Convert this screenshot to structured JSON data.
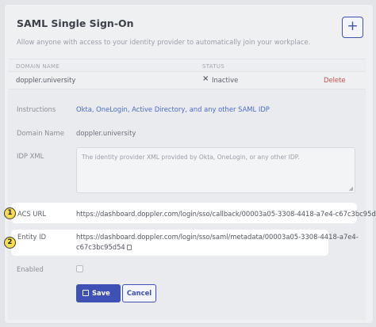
{
  "header": {
    "title": "SAML Single Sign-On",
    "subtitle": "Allow anyone with access to your identity provider to automatically join your workplace.",
    "add_label": "+"
  },
  "table": {
    "columns": [
      "DOMAIN NAME",
      "STATUS"
    ],
    "rows": [
      {
        "domain": "doppler.university",
        "status_icon": "×",
        "status": "Inactive",
        "action": "Delete"
      }
    ]
  },
  "form": {
    "instructions_label": "Instructions",
    "instructions_value": "Okta, OneLogin, Active Directory, and any other SAML IDP",
    "domain_label": "Domain Name",
    "domain_value": "doppler.university",
    "idp_label": "IDP XML",
    "idp_placeholder": "The identity provider XML provided by Okta, OneLogin, or any other IDP.",
    "acs_label": "ACS URL",
    "acs_value": "https://dashboard.doppler.com/login/sso/callback/00003a05-3308-4418-a7e4-c67c3bc95d54",
    "entity_label": "Entity ID",
    "entity_value_line1": "https://dashboard.doppler.com/login/sso/saml/metadata/00003a05-3308-4418-a7e4-",
    "entity_value_line2": "c67c3bc95d54",
    "enabled_label": "Enabled",
    "enabled_checked": false,
    "save_label": "Save",
    "cancel_label": "Cancel"
  },
  "annotations": [
    {
      "number": "1"
    },
    {
      "number": "2"
    }
  ],
  "colors": {
    "accent": "#3f51b5",
    "danger": "#c0504d",
    "link": "#4a6bc9",
    "badge": "#f7dc4e"
  },
  "icons": [
    "plus-icon",
    "close-icon",
    "resize-handle-icon",
    "copy-icon",
    "save-icon"
  ]
}
